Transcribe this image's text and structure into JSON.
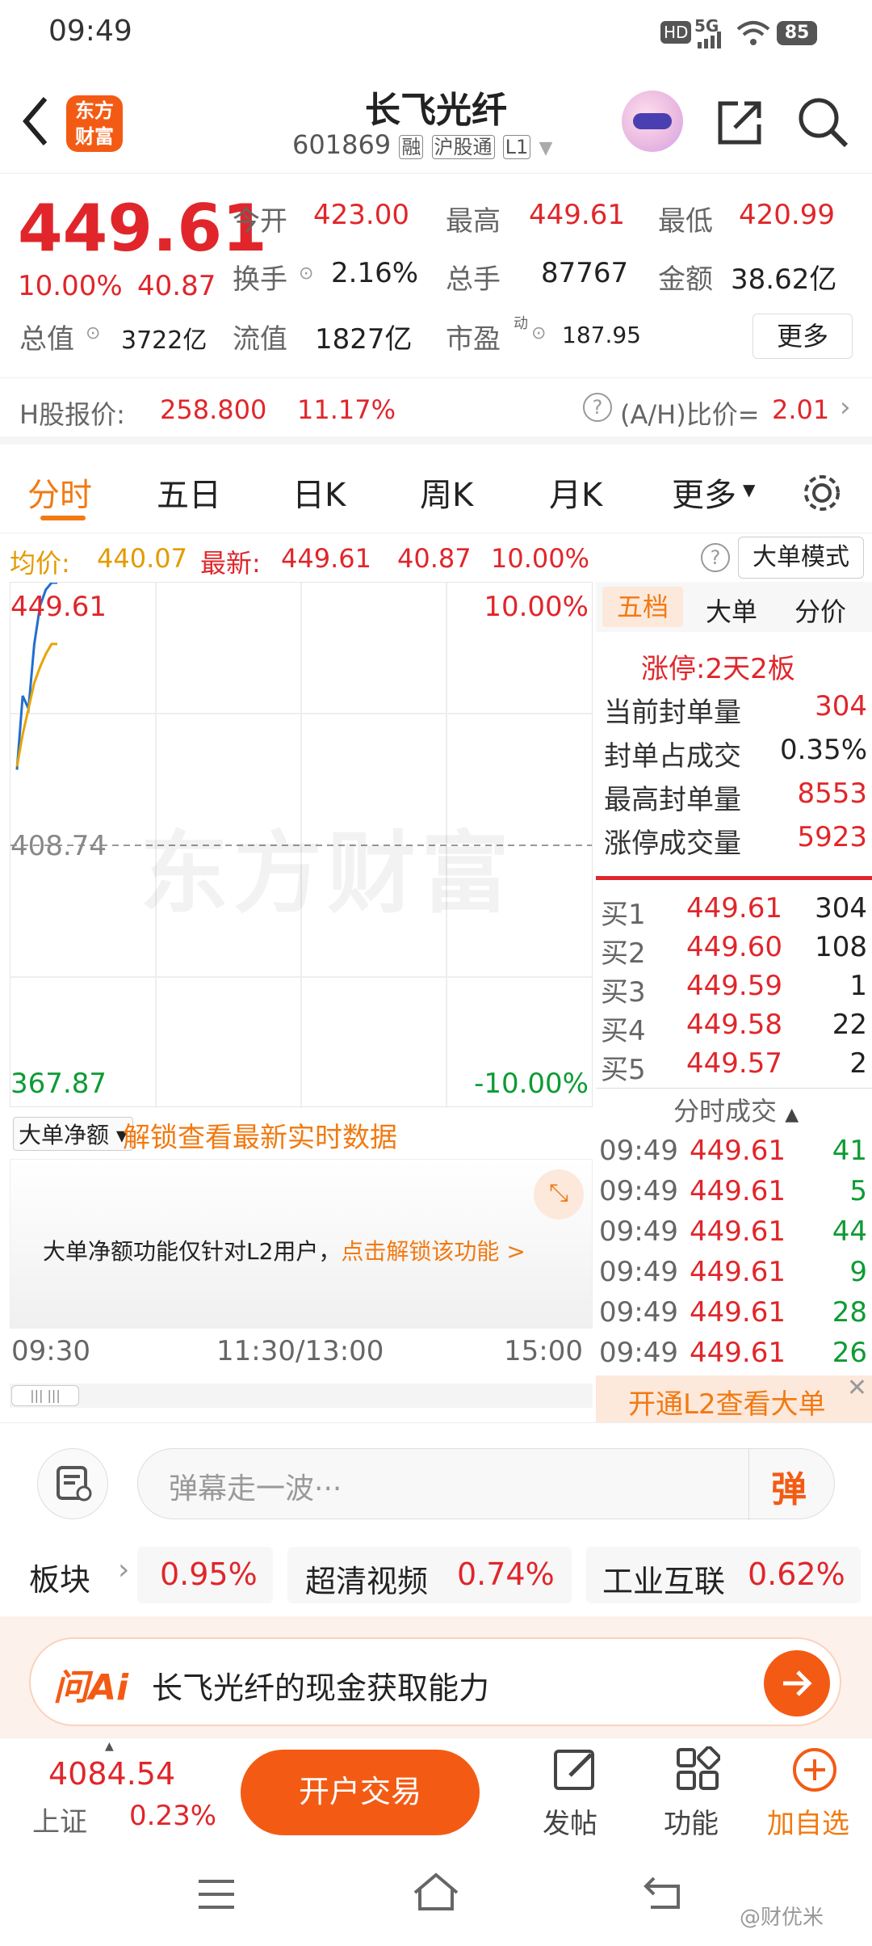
{
  "status": {
    "time": "09:49",
    "network": "5G",
    "battery": "85",
    "hd": "HD"
  },
  "header": {
    "logo_line1": "东方",
    "logo_line2": "财富",
    "title": "长飞光纤",
    "code": "601869",
    "tags": [
      "融",
      "沪股通",
      "L1"
    ]
  },
  "quote": {
    "price": "449.61",
    "pct": "10.00%",
    "chg": "40.87",
    "open_label": "今开",
    "open": "423.00",
    "high_label": "最高",
    "high": "449.61",
    "low_label": "最低",
    "low": "420.99",
    "turnover_label": "换手",
    "turnover": "2.16%",
    "volume_label": "总手",
    "volume": "87767",
    "amount_label": "金额",
    "amount": "38.62亿",
    "mktcap_label": "总值",
    "mktcap": "3722亿",
    "float_label": "流值",
    "float": "1827亿",
    "pe_label": "市盈",
    "pe_sup": "动",
    "pe": "187.95",
    "more_button": "更多"
  },
  "hshare": {
    "label": "H股报价:",
    "price": "258.800",
    "pct": "11.17%",
    "ah_label": "(A/H)比价=",
    "ah_value": "2.01"
  },
  "tabs": {
    "items": [
      "分时",
      "五日",
      "日K",
      "周K",
      "月K",
      "更多"
    ]
  },
  "infobar": {
    "avg_label": "均价:",
    "avg": "440.07",
    "latest_label": "最新:",
    "latest": "449.61",
    "chg": "40.87",
    "pct": "10.00%",
    "mode_button": "大单模式"
  },
  "chart": {
    "top_price": "449.61",
    "top_pct": "10.00%",
    "mid_price": "408.74",
    "bottom_price": "367.87",
    "bottom_pct": "-10.00%",
    "watermark": "东方财富",
    "net_selector": "大单净额",
    "unlock_text": "解锁查看最新实时数据",
    "l2_text": "大单净额功能仅针对L2用户，",
    "l2_link": "点击解锁该功能 >",
    "time_start": "09:30",
    "time_mid": "11:30/13:00",
    "time_end": "15:00"
  },
  "chart_data": {
    "type": "line",
    "xlabel": "",
    "ylabel": "",
    "ylim": [
      367.87,
      449.61
    ],
    "series": [
      {
        "values": [
          420.5,
          432,
          430,
          440,
          446,
          448.5,
          449.61,
          449.61
        ]
      },
      {
        "values": [
          420.99,
          426,
          430,
          434,
          436.5,
          438.5,
          440.07,
          440.07
        ]
      }
    ]
  },
  "panel": {
    "tabs": [
      "五档",
      "大单",
      "分价"
    ],
    "limit_label": "涨停:",
    "limit_value": "2天2板",
    "stats": [
      {
        "label": "当前封单量",
        "value": "304"
      },
      {
        "label": "封单占成交",
        "value": "0.35%"
      },
      {
        "label": "最高封单量",
        "value": "8553"
      },
      {
        "label": "涨停成交量",
        "value": "5923"
      }
    ],
    "bids": [
      {
        "label": "买1",
        "price": "449.61",
        "vol": "304"
      },
      {
        "label": "买2",
        "price": "449.60",
        "vol": "108"
      },
      {
        "label": "买3",
        "price": "449.59",
        "vol": "1"
      },
      {
        "label": "买4",
        "price": "449.58",
        "vol": "22"
      },
      {
        "label": "买5",
        "price": "449.57",
        "vol": "2"
      }
    ],
    "trades_title": "分时成交",
    "trades": [
      {
        "t": "09:49",
        "p": "449.61",
        "v": "41"
      },
      {
        "t": "09:49",
        "p": "449.61",
        "v": "5"
      },
      {
        "t": "09:49",
        "p": "449.61",
        "v": "44"
      },
      {
        "t": "09:49",
        "p": "449.61",
        "v": "9"
      },
      {
        "t": "09:49",
        "p": "449.61",
        "v": "28"
      },
      {
        "t": "09:49",
        "p": "449.61",
        "v": "26"
      }
    ],
    "l2_banner": "开通L2查看大单"
  },
  "danmu": {
    "placeholder": "弹幕走一波···",
    "send": "弹"
  },
  "sectors": {
    "label": "板块",
    "items": [
      {
        "name": "",
        "pct": "0.95%"
      },
      {
        "name": "超清视频",
        "pct": "0.74%"
      },
      {
        "name": "工业互联",
        "pct": "0.62%"
      }
    ]
  },
  "ai": {
    "logo": "问Ai",
    "text": "长飞光纤的现金获取能力"
  },
  "bottom": {
    "index_value": "4084.54",
    "index_name": "上证",
    "index_pct": "0.23%",
    "trade_button": "开户交易",
    "post": "发帖",
    "func": "功能",
    "add": "加自选"
  },
  "watermark": "@财优米"
}
